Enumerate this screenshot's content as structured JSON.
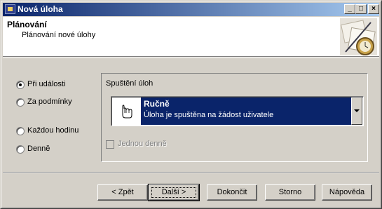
{
  "window": {
    "title": "Nová úloha"
  },
  "titlebar_buttons": {
    "minimize": "_",
    "maximize": "□",
    "close": "×"
  },
  "header": {
    "title": "Plánování",
    "subtitle": "Plánování nové úlohy"
  },
  "triggers": [
    {
      "label": "Při události",
      "checked": true
    },
    {
      "label": "Za podmínky",
      "checked": false
    },
    {
      "label": "Každou hodinu",
      "checked": false
    },
    {
      "label": "Denně",
      "checked": false
    }
  ],
  "group": {
    "title": "Spuštění úloh",
    "combo": {
      "icon": "hand-pointer-icon",
      "selected_title": "Ručně",
      "selected_desc": "Úloha je spuštěna na žádost uživatele"
    },
    "checkbox": {
      "label": "Jednou denně",
      "checked": false,
      "enabled": false
    }
  },
  "buttons": {
    "back": "< Zpět",
    "next": "Další >",
    "finish": "Dokončit",
    "cancel": "Storno",
    "help": "Nápověda"
  }
}
